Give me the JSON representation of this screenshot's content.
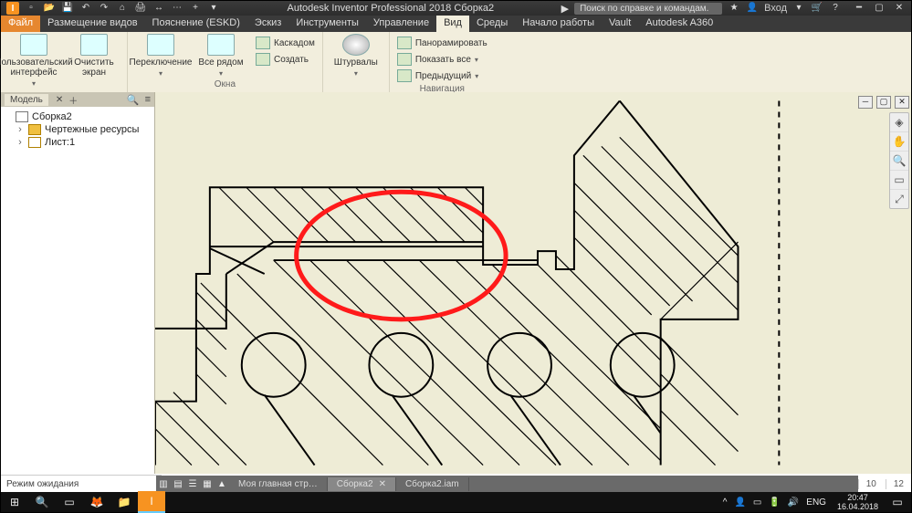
{
  "app": {
    "title": "Autodesk Inventor Professional 2018   Сборка2",
    "search_placeholder": "Поиск по справке и командам.",
    "login": "Вход"
  },
  "tabs": {
    "file": "Файл",
    "items": [
      "Размещение видов",
      "Пояснение (ESKD)",
      "Эскиз",
      "Инструменты",
      "Управление",
      "Вид",
      "Среды",
      "Начало работы",
      "Vault",
      "Autodesk A360"
    ],
    "active": "Вид"
  },
  "ribbon": {
    "g1": {
      "label": "",
      "btn1": "Пользовательский интерфейс",
      "btn2": "Очистить экран"
    },
    "g2": {
      "label": "Окна",
      "btn1": "Переключение",
      "btn2": "Все рядом",
      "s1": "Каскадом",
      "s2": "Создать"
    },
    "g3": {
      "label": "",
      "btn": "Штурвалы"
    },
    "g4": {
      "label": "Навигация",
      "s1": "Панорамировать",
      "s2": "Показать все",
      "s3": "Предыдущий"
    }
  },
  "browser": {
    "tab": "Модель",
    "root": "Сборка2",
    "items": [
      "Чертежные ресурсы",
      "Лист:1"
    ]
  },
  "doctabs": {
    "items": [
      {
        "label": "Моя главная стр…",
        "close": false
      },
      {
        "label": "Сборка2",
        "close": true,
        "active": true
      },
      {
        "label": "Сборка2.iam",
        "close": false
      }
    ]
  },
  "status": {
    "text": "Режим ожидания",
    "n1": "10",
    "n2": "12"
  },
  "tray": {
    "lang": "ENG",
    "time": "20:47",
    "date": "16.04.2018"
  }
}
